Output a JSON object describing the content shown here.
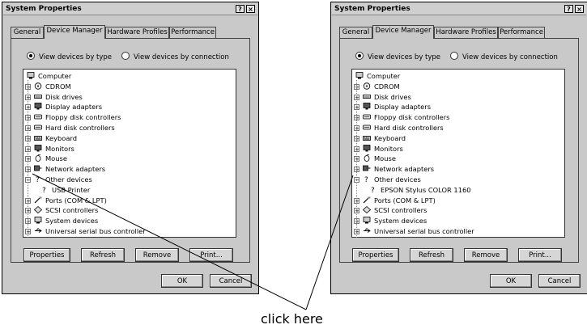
{
  "left": {
    "title": "System Properties",
    "help_button": "?",
    "close_button": "×",
    "tabs": [
      "General",
      "Device Manager",
      "Hardware Profiles",
      "Performance"
    ],
    "radio_by_type": "View devices by type",
    "radio_by_connection": "View devices by connection",
    "tree": [
      {
        "label": "Computer",
        "icon": "computer-icon",
        "exp": ""
      },
      {
        "label": "CDROM",
        "icon": "cdrom-icon",
        "exp": "+"
      },
      {
        "label": "Disk drives",
        "icon": "disk-icon",
        "exp": "+"
      },
      {
        "label": "Display adapters",
        "icon": "monitor-icon",
        "exp": "+"
      },
      {
        "label": "Floppy disk controllers",
        "icon": "controller-icon",
        "exp": "+"
      },
      {
        "label": "Hard disk controllers",
        "icon": "controller-icon",
        "exp": "+"
      },
      {
        "label": "Keyboard",
        "icon": "keyboard-icon",
        "exp": "+"
      },
      {
        "label": "Monitors",
        "icon": "monitor-icon",
        "exp": "+"
      },
      {
        "label": "Mouse",
        "icon": "mouse-icon",
        "exp": "+"
      },
      {
        "label": "Network adapters",
        "icon": "network-icon",
        "exp": "+"
      },
      {
        "label": "Other devices",
        "icon": "question-icon",
        "exp": "−"
      },
      {
        "label": "USB Printer",
        "icon": "question-icon",
        "exp": "",
        "child": true
      },
      {
        "label": "Ports (COM & LPT)",
        "icon": "port-icon",
        "exp": "+"
      },
      {
        "label": "SCSI controllers",
        "icon": "scsi-icon",
        "exp": "+"
      },
      {
        "label": "System devices",
        "icon": "computer-icon",
        "exp": "+"
      },
      {
        "label": "Universal serial bus controller",
        "icon": "usb-icon",
        "exp": "+"
      }
    ],
    "buttons": [
      "Properties",
      "Refresh",
      "Remove",
      "Print..."
    ],
    "ok": "OK",
    "cancel": "Cancel"
  },
  "right": {
    "title": "System Properties",
    "help_button": "?",
    "close_button": "×",
    "tabs": [
      "General",
      "Device Manager",
      "Hardware Profiles",
      "Performance"
    ],
    "radio_by_type": "View devices by type",
    "radio_by_connection": "View devices by connection",
    "tree": [
      {
        "label": "Computer",
        "icon": "computer-icon",
        "exp": ""
      },
      {
        "label": "CDROM",
        "icon": "cdrom-icon",
        "exp": "+"
      },
      {
        "label": "Disk drives",
        "icon": "disk-icon",
        "exp": "+"
      },
      {
        "label": "Display adapters",
        "icon": "monitor-icon",
        "exp": "+"
      },
      {
        "label": "Floppy disk controllers",
        "icon": "controller-icon",
        "exp": "+"
      },
      {
        "label": "Hard disk controllers",
        "icon": "controller-icon",
        "exp": "+"
      },
      {
        "label": "Keyboard",
        "icon": "keyboard-icon",
        "exp": "+"
      },
      {
        "label": "Monitors",
        "icon": "monitor-icon",
        "exp": "+"
      },
      {
        "label": "Mouse",
        "icon": "mouse-icon",
        "exp": "+"
      },
      {
        "label": "Network adapters",
        "icon": "network-icon",
        "exp": "+"
      },
      {
        "label": "Other devices",
        "icon": "question-icon",
        "exp": "−"
      },
      {
        "label": "EPSON Stylus COLOR 1160",
        "icon": "question-icon",
        "exp": "",
        "child": true
      },
      {
        "label": "Ports (COM & LPT)",
        "icon": "port-icon",
        "exp": "+"
      },
      {
        "label": "SCSI controllers",
        "icon": "scsi-icon",
        "exp": "+"
      },
      {
        "label": "System devices",
        "icon": "computer-icon",
        "exp": "+"
      },
      {
        "label": "Universal serial bus controller",
        "icon": "usb-icon",
        "exp": "+"
      }
    ],
    "buttons": [
      "Properties",
      "Refresh",
      "Remove",
      "Print..."
    ],
    "ok": "OK",
    "cancel": "Cancel"
  },
  "caption": "click here"
}
